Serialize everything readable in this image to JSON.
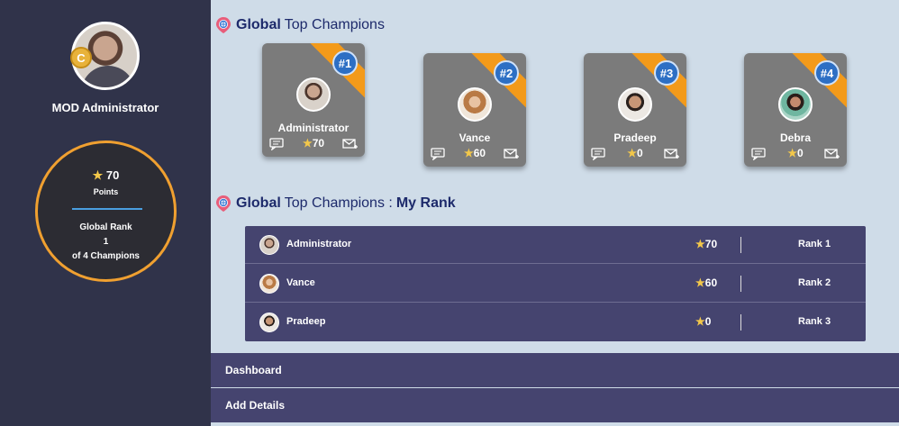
{
  "profile": {
    "name": "MOD Administrator",
    "badge_letter": "C",
    "points": "70",
    "points_label": "Points",
    "global_rank_label": "Global Rank",
    "global_rank_value": "1",
    "champions_text": "of 4 Champions"
  },
  "section_top": {
    "strong": "Global",
    "rest": "Top Champions"
  },
  "section_rank": {
    "strong": "Global",
    "rest": "Top Champions :",
    "strong2": "My Rank"
  },
  "champions": [
    {
      "rank": "#1",
      "name": "Administrator",
      "points": "70"
    },
    {
      "rank": "#2",
      "name": "Vance",
      "points": "60"
    },
    {
      "rank": "#3",
      "name": "Pradeep",
      "points": "0"
    },
    {
      "rank": "#4",
      "name": "Debra",
      "points": "0"
    }
  ],
  "rank_rows": [
    {
      "name": "Administrator",
      "points": "70",
      "rank": "Rank 1"
    },
    {
      "name": "Vance",
      "points": "60",
      "rank": "Rank 2"
    },
    {
      "name": "Pradeep",
      "points": "0",
      "rank": "Rank 3"
    }
  ],
  "nav": {
    "dashboard": "Dashboard",
    "add_details": "Add Details"
  },
  "colors": {
    "sidebar": "#30334a",
    "accent_orange": "#f39a1a",
    "table": "#45446f",
    "background": "#cfdce8",
    "star": "#f3c84a"
  }
}
